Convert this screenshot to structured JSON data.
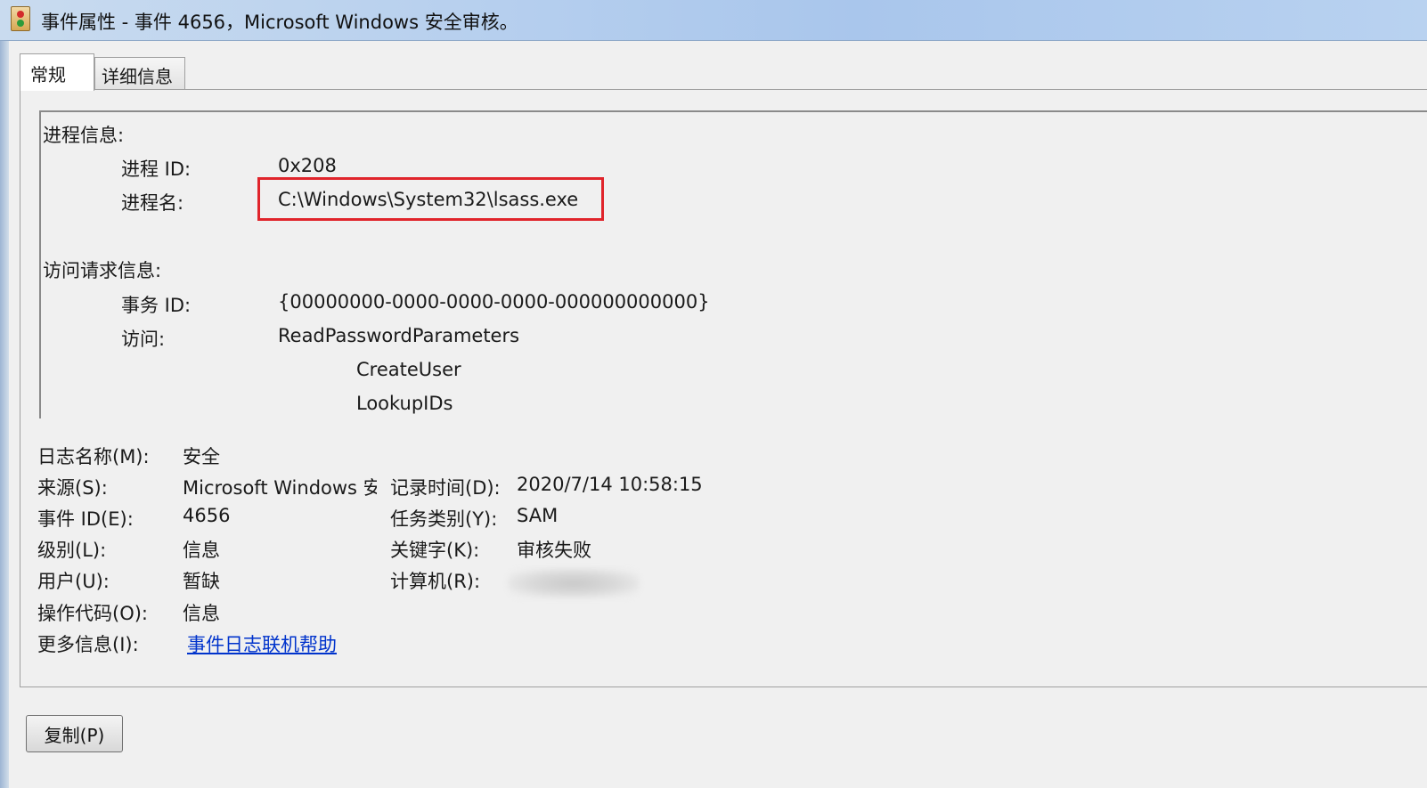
{
  "window": {
    "title": "事件属性 - 事件 4656，Microsoft Windows 安全审核。",
    "icon": "event-log-icon"
  },
  "tabs": [
    {
      "label": "常规",
      "active": true
    },
    {
      "label": "详细信息",
      "active": false
    }
  ],
  "description": {
    "process_section": "进程信息:",
    "process_id_label": "进程 ID:",
    "process_id_value": "0x208",
    "process_name_label": "进程名:",
    "process_name_value": "C:\\Windows\\System32\\lsass.exe",
    "access_section": "访问请求信息:",
    "transaction_id_label": "事务 ID:",
    "transaction_id_value": "{00000000-0000-0000-0000-000000000000}",
    "access_label": "访问:",
    "access_values": [
      "ReadPasswordParameters",
      "CreateUser",
      "LookupIDs"
    ]
  },
  "properties": {
    "log_name_label": "日志名称(M):",
    "log_name_value": "安全",
    "source_label": "来源(S):",
    "source_value": "Microsoft Windows 安全审核",
    "logged_label": "记录时间(D):",
    "logged_value": "2020/7/14 10:58:15",
    "event_id_label": "事件 ID(E):",
    "event_id_value": "4656",
    "task_category_label": "任务类别(Y):",
    "task_category_value": "SAM",
    "level_label": "级别(L):",
    "level_value": "信息",
    "keywords_label": "关键字(K):",
    "keywords_value": "审核失败",
    "user_label": "用户(U):",
    "user_value": "暂缺",
    "computer_label": "计算机(R):",
    "opcode_label": "操作代码(O):",
    "opcode_value": "信息",
    "more_info_label": "更多信息(I):",
    "more_info_link": "事件日志联机帮助"
  },
  "buttons": {
    "copy_label": "复制(P)"
  },
  "colors": {
    "highlight_border": "#e0242b",
    "link": "#0033cc",
    "dialog_bg": "#f0f0f0"
  }
}
